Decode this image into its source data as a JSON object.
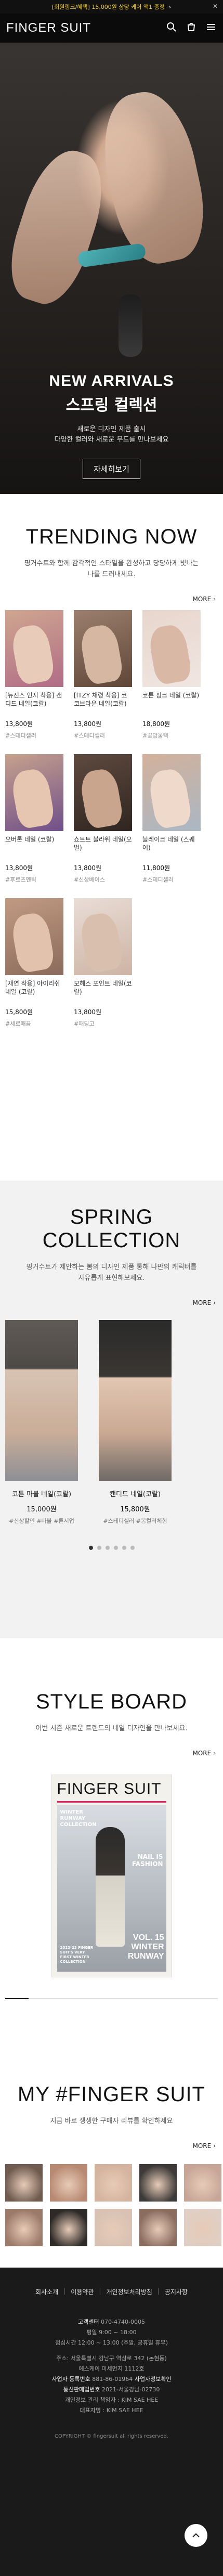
{
  "promo": {
    "text": "[회원링크/혜택] 15,000원 상당 케어 액1 증정",
    "arrow": "›",
    "close": "✕"
  },
  "header": {
    "logo": "FINGER SUIT",
    "icons": [
      "search-icon",
      "cart-icon",
      "menu-icon"
    ]
  },
  "hero": {
    "eyebrow": "NEW ARRIVALS",
    "title": "스프링 컬렉션",
    "desc_line1": "새로운 디자인 제품 출시",
    "desc_line2": "다양한 컬러와 새로운 무드를 만나보세요",
    "button": "자세히보기"
  },
  "trending": {
    "title": "TRENDING NOW",
    "desc_line1": "핑거수트와 함께 감각적인 스타일을 완성하고 당당하게 빛나는",
    "desc_line2": "나를 드러내세요.",
    "more": "MORE",
    "products": [
      {
        "name": "[뉴진스 인지 착용] 캔디드 네일(코랄)",
        "price": "13,800원",
        "tags": "#스테디셀러"
      },
      {
        "name": "[ITZY 채령 착용] 코코브라운 네일(코랄)",
        "price": "13,800원",
        "tags": "#스테디셀러"
      },
      {
        "name": "코튼 핑크 네일 (코랄)",
        "price": "18,800원",
        "tags": "#꽃망울택"
      },
      {
        "name": "오버톤 네일 (코랄)",
        "price": "13,800원",
        "tags": "#후르츠멘틱"
      },
      {
        "name": "쇼트트 블라위 네일(오벌)",
        "price": "13,800원",
        "tags": "#신상베이스"
      },
      {
        "name": "블레이크 네일 (스퀘어)",
        "price": "11,800원",
        "tags": "#스테디셀러"
      },
      {
        "name": "[재연 착용] 아이리쉬 네일 (코랄)",
        "price": "15,800원",
        "tags": "#세로매끔"
      },
      {
        "name": "모헤스 포인트 네일(코랄)",
        "price": "13,800원",
        "tags": "#패딩고"
      }
    ]
  },
  "spring": {
    "title": "SPRING COLLECTION",
    "desc_line1": "핑거수트가 제안하는 봄의 디자인 제품 통해 나만의 캐릭터를",
    "desc_line2": "자유롭게 표현해보세요.",
    "more": "MORE",
    "cards": [
      {
        "name": "코튼 마블 네일(코랄)",
        "price": "15,000원",
        "tags": "#신상할인 #마블 #튼시업"
      },
      {
        "name": "캔디드 네일(코랄)",
        "price": "15,800원",
        "tags": "#스테디셀러 #봄컬러체험"
      }
    ],
    "dots": 6,
    "active_dot": 0
  },
  "styleboard": {
    "title": "STYLE BOARD",
    "desc": "이번 시즌 새로운 트렌드의 네일 디자인을 만나보세요.",
    "more": "MORE",
    "mag": {
      "masthead": "FINGER SUIT",
      "side_text": "WINTER RUNWAY COLLECTION",
      "mid_text": "NAIL IS FASHION",
      "vol_line1": "VOL. 15",
      "vol_line2": "WINTER",
      "vol_line3": "RUNWAY",
      "left_small": "2022-23 FINGER SUIT'S VERY FIRST WINTER COLLECTION"
    },
    "progress": 0.11
  },
  "myfs": {
    "title": "MY #FINGER SUIT",
    "desc": "지금 바로 생생한 구매자 리뷰를 확인하세요",
    "more": "MORE"
  },
  "footer": {
    "nav": [
      "회사소개",
      "이용약관",
      "개인정보처리방침",
      "공지사항"
    ],
    "customer_center": "고객센터",
    "phone": "070-4740-0005",
    "hours_label": "평일",
    "hours": "9:00 ~ 18:00",
    "lunch": "점심시간 12:00 ~ 13:00 (주말, 공휴일 휴무)",
    "addr": "주소: 서울특별시 강남구 역삼로 342 (논현동)",
    "partner": "에스케이 미세먼지 1112호",
    "biz_label": "사업자 등록번호",
    "biz_no": "881-86-01964",
    "biz_check": "사업자정보확인",
    "tel_label": "통신판매업번호",
    "tel_no": "2021-서울강남-02730",
    "privacy": "개인정보 관리 책임자 : KIM SAE HEE",
    "ceo": "대표자명 : KIM SAE HEE",
    "copyright": "COPYRIGHT © fingersuit all rights reserved.",
    "top_icon": "arrow-up-icon"
  }
}
